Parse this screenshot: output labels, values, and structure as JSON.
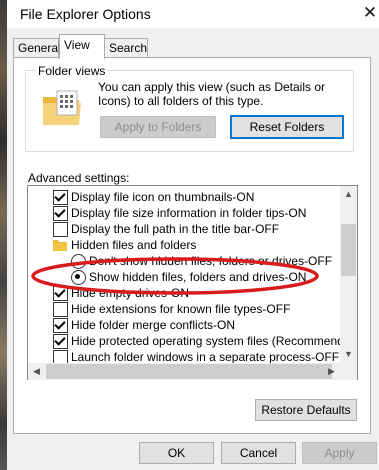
{
  "window": {
    "title": "File Explorer Options",
    "close_glyph": "✕"
  },
  "tabs": [
    {
      "label": "General"
    },
    {
      "label": "View"
    },
    {
      "label": "Search"
    }
  ],
  "folder_views": {
    "legend": "Folder views",
    "description": "You can apply this view (such as Details or Icons) to all folders of this type.",
    "apply_label": "Apply to Folders",
    "reset_label": "Reset Folders"
  },
  "advanced": {
    "label": "Advanced settings:",
    "items": [
      {
        "kind": "checkbox",
        "checked": true,
        "label": "Display file icon on thumbnails-ON"
      },
      {
        "kind": "checkbox",
        "checked": true,
        "label": "Display file size information in folder tips-ON"
      },
      {
        "kind": "checkbox",
        "checked": false,
        "label": "Display the full path in the title bar-OFF"
      },
      {
        "kind": "folder",
        "label": "Hidden files and folders"
      },
      {
        "kind": "radio",
        "checked": false,
        "label": "Don't show hidden files, folders or drives-OFF"
      },
      {
        "kind": "radio",
        "checked": true,
        "label": "Show hidden files, folders and drives-ON"
      },
      {
        "kind": "checkbox",
        "checked": true,
        "label": "Hide empty drives-ON"
      },
      {
        "kind": "checkbox",
        "checked": false,
        "label": "Hide extensions for known file types-OFF"
      },
      {
        "kind": "checkbox",
        "checked": true,
        "label": "Hide folder merge conflicts-ON"
      },
      {
        "kind": "checkbox",
        "checked": true,
        "label": "Hide protected operating system files (Recommended)-ON"
      },
      {
        "kind": "checkbox",
        "checked": false,
        "label": "Launch folder windows in a separate process-OFF"
      }
    ]
  },
  "restore_defaults_label": "Restore Defaults",
  "buttons": {
    "ok": "OK",
    "cancel": "Cancel",
    "apply": "Apply"
  },
  "scroll_glyphs": {
    "up": "▲",
    "down": "▼",
    "left": "◀",
    "right": "▶"
  },
  "colors": {
    "focus_border": "#0078d7",
    "annotation": "#d81b1b",
    "folder": "#f5c542"
  }
}
